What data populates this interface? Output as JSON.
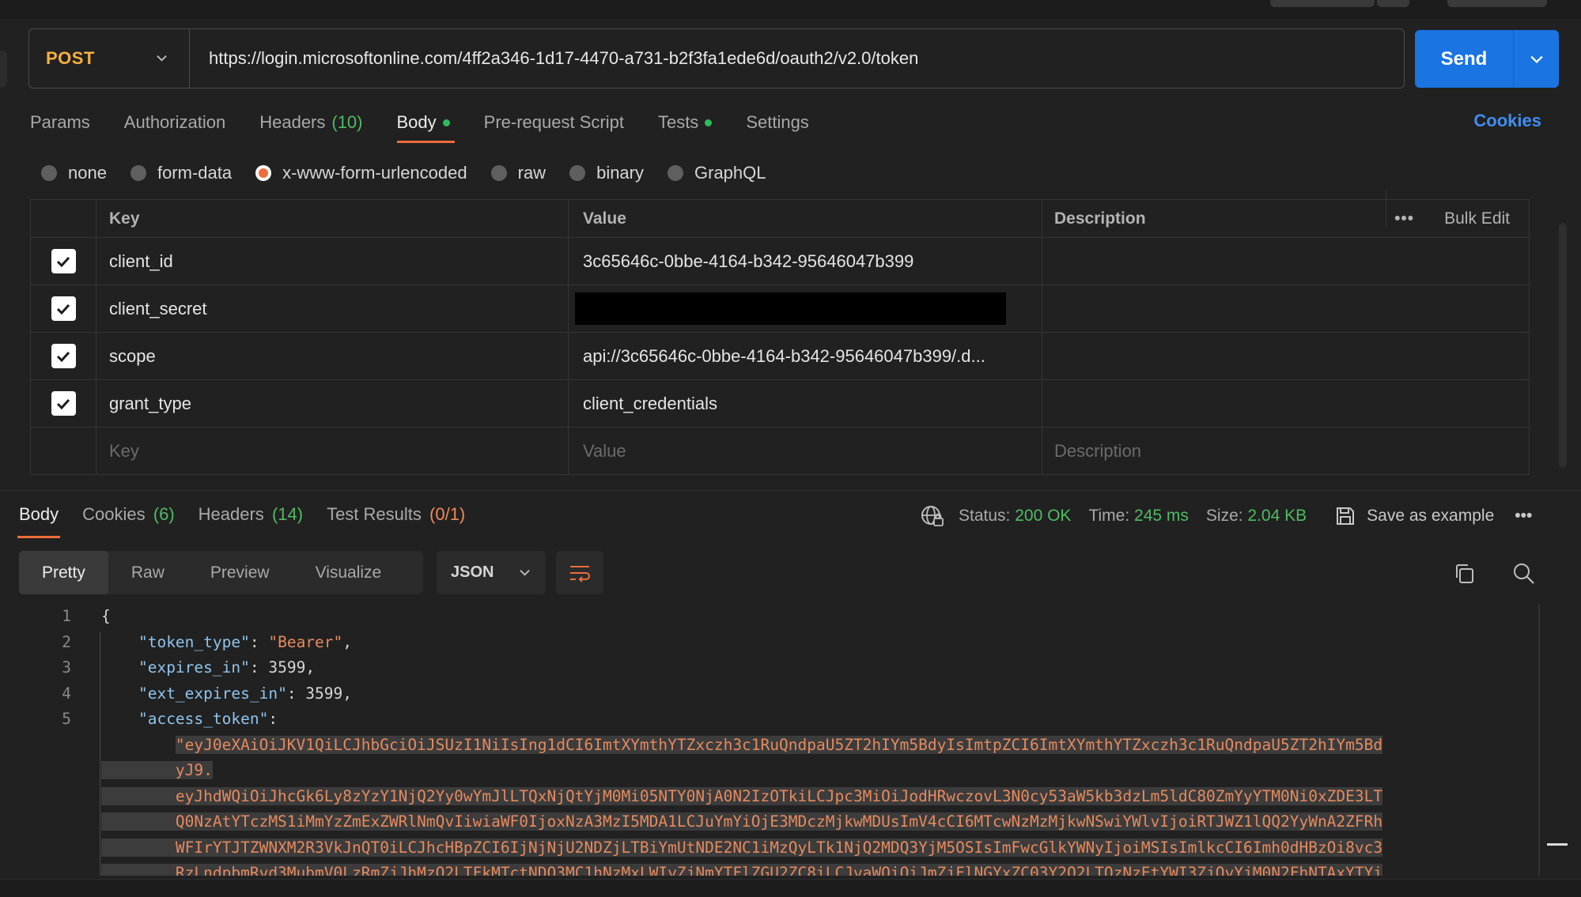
{
  "request": {
    "method": "POST",
    "url": "https://login.microsoftonline.com/4ff2a346-1d17-4470-a731-b2f3fa1ede6d/oauth2/v2.0/token",
    "send_label": "Send"
  },
  "request_tabs": {
    "params": "Params",
    "authorization": "Authorization",
    "headers": "Headers",
    "headers_count": "(10)",
    "body": "Body",
    "prerequest": "Pre-request Script",
    "tests": "Tests",
    "settings": "Settings",
    "cookies": "Cookies"
  },
  "body_types": {
    "none": "none",
    "form_data": "form-data",
    "urlencoded": "x-www-form-urlencoded",
    "raw": "raw",
    "binary": "binary",
    "graphql": "GraphQL",
    "selected": "x-www-form-urlencoded"
  },
  "params_table": {
    "headers": {
      "key": "Key",
      "value": "Value",
      "description": "Description",
      "bulk_edit": "Bulk Edit",
      "more": "•••"
    },
    "rows": [
      {
        "key": "client_id",
        "value": "3c65646c-0bbe-4164-b342-95646047b399",
        "checked": true
      },
      {
        "key": "client_secret",
        "value": "",
        "checked": true
      },
      {
        "key": "scope",
        "value": "api://3c65646c-0bbe-4164-b342-95646047b399/.d...",
        "checked": true
      },
      {
        "key": "grant_type",
        "value": "client_credentials",
        "checked": true
      }
    ],
    "placeholders": {
      "key": "Key",
      "value": "Value",
      "description": "Description"
    }
  },
  "response_tabs": {
    "body": "Body",
    "cookies": "Cookies",
    "cookies_count": "(6)",
    "headers": "Headers",
    "headers_count": "(14)",
    "test_results": "Test Results",
    "test_results_count": "(0/1)"
  },
  "response_meta": {
    "status_label": "Status:",
    "status": "200 OK",
    "time_label": "Time:",
    "time": "245 ms",
    "size_label": "Size:",
    "size": "2.04 KB",
    "save_example": "Save as example",
    "more": "•••"
  },
  "response_view": {
    "modes": [
      "Pretty",
      "Raw",
      "Preview",
      "Visualize"
    ],
    "active": "Pretty",
    "format": "JSON"
  },
  "code": {
    "line_numbers": [
      "1",
      "2",
      "3",
      "4",
      "5"
    ],
    "open_brace": "{",
    "token_type_key": "\"token_type\"",
    "token_type_val": "\"Bearer\"",
    "expires_in_key": "\"expires_in\"",
    "expires_in_val": "3599",
    "ext_expires_in_key": "\"ext_expires_in\"",
    "ext_expires_in_val": "3599",
    "access_token_key": "\"access_token\"",
    "access_token_lines": [
      "\"eyJ0eXAiOiJKV1QiLCJhbGciOiJSUzI1NiIsIng1dCI6ImtXYmthYTZxczh3c1RuQndpaU5ZT2hIYm5BdyIsImtpZCI6ImtXYmthYTZxczh3c1RuQndpaU5ZT2hIYm5Bd",
      "yJ9.",
      "eyJhdWQiOiJhcGk6Ly8zYzY1NjQ2Yy0wYmJlLTQxNjQtYjM0Mi05NTY0NjA0N2IzOTkiLCJpc3MiOiJodHRwczovL3N0cy53aW5kb3dzLm5ldC80ZmYyYTM0Ni0xZDE3LT",
      "Q0NzAtYTczMS1iMmYzZmExZWRlNmQvIiwiaWF0IjoxNzA3MzI5MDA1LCJuYmYiOjE3MDczMjkwMDUsImV4cCI6MTcwNzMzMjkwNSwiYWlvIjoiRTJWZ1lQQ2YyWnA2ZFRh",
      "WFIrYTJTZWNXM2R3VkJnQT0iLCJhcHBpZCI6IjNjNjU2NDZjLTBiYmUtNDE2NC1iMzQyLTk1NjQ2MDQ3YjM5OSIsImFwcGlkYWNyIjoiMSIsImlkcCI6Imh0dHBzOi8vc3",
      "RzLndpbmRvd3MubmV0LzRmZjJhMzQ2LTFkMTctNDQ3MC1hNzMxLWIyZjNmYTFlZGU2ZC8iLCJvaWQiOiJmZjFlNGYxZC03Y2Q2LTQzNzEtYWI3ZjQyYjM0N2FhNTAxYTYi"
    ]
  }
}
